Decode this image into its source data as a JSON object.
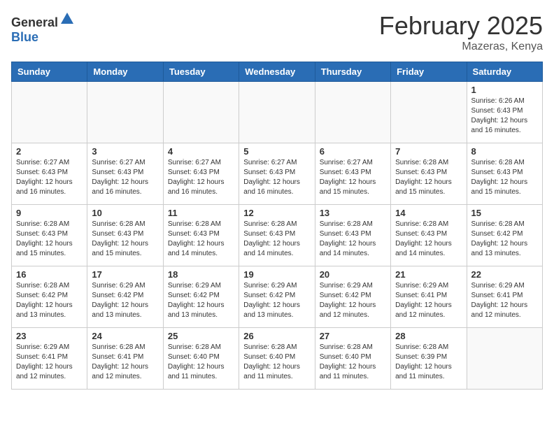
{
  "header": {
    "logo_general": "General",
    "logo_blue": "Blue",
    "month_year": "February 2025",
    "location": "Mazeras, Kenya"
  },
  "days_of_week": [
    "Sunday",
    "Monday",
    "Tuesday",
    "Wednesday",
    "Thursday",
    "Friday",
    "Saturday"
  ],
  "weeks": [
    [
      {
        "day": "",
        "info": ""
      },
      {
        "day": "",
        "info": ""
      },
      {
        "day": "",
        "info": ""
      },
      {
        "day": "",
        "info": ""
      },
      {
        "day": "",
        "info": ""
      },
      {
        "day": "",
        "info": ""
      },
      {
        "day": "1",
        "info": "Sunrise: 6:26 AM\nSunset: 6:43 PM\nDaylight: 12 hours and 16 minutes."
      }
    ],
    [
      {
        "day": "2",
        "info": "Sunrise: 6:27 AM\nSunset: 6:43 PM\nDaylight: 12 hours and 16 minutes."
      },
      {
        "day": "3",
        "info": "Sunrise: 6:27 AM\nSunset: 6:43 PM\nDaylight: 12 hours and 16 minutes."
      },
      {
        "day": "4",
        "info": "Sunrise: 6:27 AM\nSunset: 6:43 PM\nDaylight: 12 hours and 16 minutes."
      },
      {
        "day": "5",
        "info": "Sunrise: 6:27 AM\nSunset: 6:43 PM\nDaylight: 12 hours and 16 minutes."
      },
      {
        "day": "6",
        "info": "Sunrise: 6:27 AM\nSunset: 6:43 PM\nDaylight: 12 hours and 15 minutes."
      },
      {
        "day": "7",
        "info": "Sunrise: 6:28 AM\nSunset: 6:43 PM\nDaylight: 12 hours and 15 minutes."
      },
      {
        "day": "8",
        "info": "Sunrise: 6:28 AM\nSunset: 6:43 PM\nDaylight: 12 hours and 15 minutes."
      }
    ],
    [
      {
        "day": "9",
        "info": "Sunrise: 6:28 AM\nSunset: 6:43 PM\nDaylight: 12 hours and 15 minutes."
      },
      {
        "day": "10",
        "info": "Sunrise: 6:28 AM\nSunset: 6:43 PM\nDaylight: 12 hours and 15 minutes."
      },
      {
        "day": "11",
        "info": "Sunrise: 6:28 AM\nSunset: 6:43 PM\nDaylight: 12 hours and 14 minutes."
      },
      {
        "day": "12",
        "info": "Sunrise: 6:28 AM\nSunset: 6:43 PM\nDaylight: 12 hours and 14 minutes."
      },
      {
        "day": "13",
        "info": "Sunrise: 6:28 AM\nSunset: 6:43 PM\nDaylight: 12 hours and 14 minutes."
      },
      {
        "day": "14",
        "info": "Sunrise: 6:28 AM\nSunset: 6:43 PM\nDaylight: 12 hours and 14 minutes."
      },
      {
        "day": "15",
        "info": "Sunrise: 6:28 AM\nSunset: 6:42 PM\nDaylight: 12 hours and 13 minutes."
      }
    ],
    [
      {
        "day": "16",
        "info": "Sunrise: 6:28 AM\nSunset: 6:42 PM\nDaylight: 12 hours and 13 minutes."
      },
      {
        "day": "17",
        "info": "Sunrise: 6:29 AM\nSunset: 6:42 PM\nDaylight: 12 hours and 13 minutes."
      },
      {
        "day": "18",
        "info": "Sunrise: 6:29 AM\nSunset: 6:42 PM\nDaylight: 12 hours and 13 minutes."
      },
      {
        "day": "19",
        "info": "Sunrise: 6:29 AM\nSunset: 6:42 PM\nDaylight: 12 hours and 13 minutes."
      },
      {
        "day": "20",
        "info": "Sunrise: 6:29 AM\nSunset: 6:42 PM\nDaylight: 12 hours and 12 minutes."
      },
      {
        "day": "21",
        "info": "Sunrise: 6:29 AM\nSunset: 6:41 PM\nDaylight: 12 hours and 12 minutes."
      },
      {
        "day": "22",
        "info": "Sunrise: 6:29 AM\nSunset: 6:41 PM\nDaylight: 12 hours and 12 minutes."
      }
    ],
    [
      {
        "day": "23",
        "info": "Sunrise: 6:29 AM\nSunset: 6:41 PM\nDaylight: 12 hours and 12 minutes."
      },
      {
        "day": "24",
        "info": "Sunrise: 6:28 AM\nSunset: 6:41 PM\nDaylight: 12 hours and 12 minutes."
      },
      {
        "day": "25",
        "info": "Sunrise: 6:28 AM\nSunset: 6:40 PM\nDaylight: 12 hours and 11 minutes."
      },
      {
        "day": "26",
        "info": "Sunrise: 6:28 AM\nSunset: 6:40 PM\nDaylight: 12 hours and 11 minutes."
      },
      {
        "day": "27",
        "info": "Sunrise: 6:28 AM\nSunset: 6:40 PM\nDaylight: 12 hours and 11 minutes."
      },
      {
        "day": "28",
        "info": "Sunrise: 6:28 AM\nSunset: 6:39 PM\nDaylight: 12 hours and 11 minutes."
      },
      {
        "day": "",
        "info": ""
      }
    ]
  ]
}
